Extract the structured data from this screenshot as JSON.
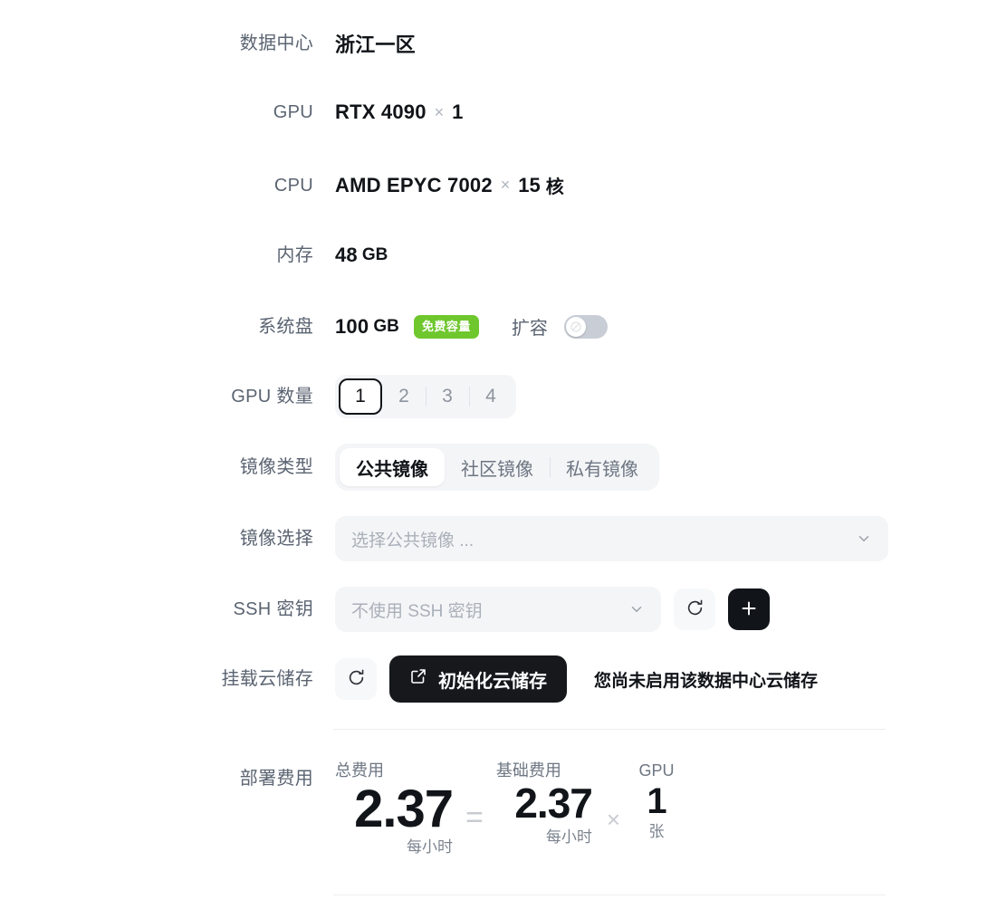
{
  "rows": {
    "datacenter": {
      "label": "数据中心",
      "value": "浙江一区"
    },
    "gpu": {
      "label": "GPU",
      "model": "RTX 4090",
      "mult": "×",
      "count": "1"
    },
    "cpu": {
      "label": "CPU",
      "model": "AMD EPYC 7002",
      "mult": "×",
      "count": "15",
      "unit": "核"
    },
    "memory": {
      "label": "内存",
      "value": "48",
      "unit": "GB"
    },
    "disk": {
      "label": "系统盘",
      "value": "100",
      "unit": "GB",
      "badge": "免费容量",
      "expand_label": "扩容",
      "toggle_state": "off"
    },
    "gpu_count": {
      "label": "GPU 数量",
      "options": [
        "1",
        "2",
        "3",
        "4"
      ],
      "selected": "1"
    },
    "image_type": {
      "label": "镜像类型",
      "options": [
        "公共镜像",
        "社区镜像",
        "私有镜像"
      ],
      "selected": "公共镜像"
    },
    "image_pick": {
      "label": "镜像选择",
      "placeholder": "选择公共镜像 ..."
    },
    "ssh": {
      "label": "SSH 密钥",
      "placeholder": "不使用 SSH 密钥",
      "refresh_title": "刷新",
      "add_title": "新增"
    },
    "storage": {
      "label": "挂载云储存",
      "refresh_title": "刷新",
      "button": "初始化云储存",
      "notice": "您尚未启用该数据中心云储存"
    },
    "cost": {
      "label": "部署费用"
    }
  },
  "cost": {
    "total": {
      "caption": "总费用",
      "amount": "2.37",
      "unit": "每小时"
    },
    "op_equals": "=",
    "base": {
      "caption": "基础费用",
      "amount": "2.37",
      "unit": "每小时"
    },
    "op_times": "×",
    "gpu": {
      "caption": "GPU",
      "amount": "1",
      "unit": "张"
    }
  },
  "colors": {
    "accent_green": "#6fc72e",
    "dark": "#111418",
    "label_gray": "#5b6472",
    "field_bg": "#f4f5f7"
  }
}
